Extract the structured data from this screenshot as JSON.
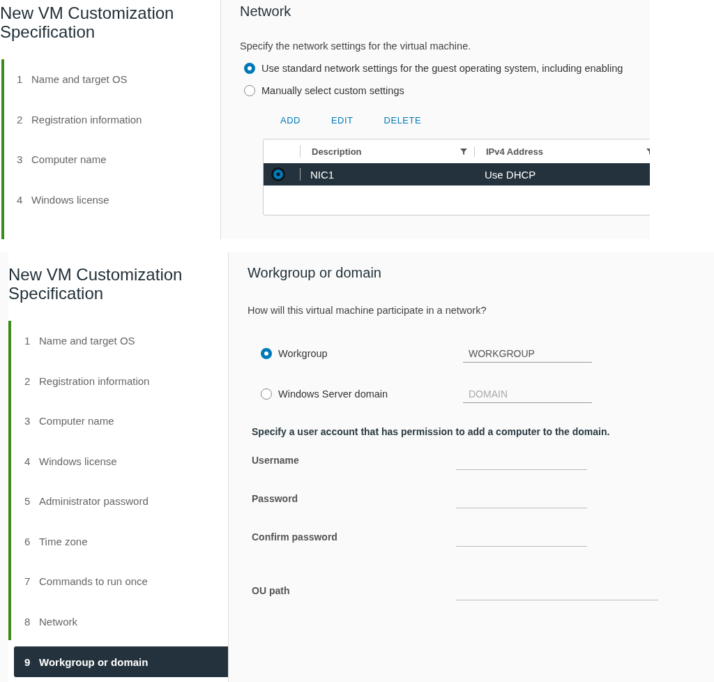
{
  "panels": [
    {
      "kind": "network",
      "title": "New VM Customization Specification",
      "steps": [
        {
          "number": "1",
          "label": "Name and target OS",
          "selected": false
        },
        {
          "number": "2",
          "label": "Registration information",
          "selected": false
        },
        {
          "number": "3",
          "label": "Computer name",
          "selected": false
        },
        {
          "number": "4",
          "label": "Windows license",
          "selected": false
        }
      ],
      "heading": "Network",
      "description": "Specify the network settings for the virtual machine.",
      "options": [
        {
          "label": "Use standard network settings for the guest operating system, including enabling",
          "selected": true
        },
        {
          "label": "Manually select custom settings",
          "selected": false
        }
      ],
      "actions": [
        "ADD",
        "EDIT",
        "DELETE"
      ],
      "table": {
        "columns": [
          "Description",
          "IPv4 Address"
        ],
        "rows": [
          {
            "cells": [
              "NIC1",
              "Use DHCP"
            ],
            "selected": true
          }
        ]
      }
    },
    {
      "kind": "workgroup",
      "title": "New VM Customization Specification",
      "steps": [
        {
          "number": "1",
          "label": "Name and target OS",
          "selected": false
        },
        {
          "number": "2",
          "label": "Registration information",
          "selected": false
        },
        {
          "number": "3",
          "label": "Computer name",
          "selected": false
        },
        {
          "number": "4",
          "label": "Windows license",
          "selected": false
        },
        {
          "number": "5",
          "label": "Administrator password",
          "selected": false
        },
        {
          "number": "6",
          "label": "Time zone",
          "selected": false
        },
        {
          "number": "7",
          "label": "Commands to run once",
          "selected": false
        },
        {
          "number": "8",
          "label": "Network",
          "selected": false
        },
        {
          "number": "9",
          "label": "Workgroup or domain",
          "selected": true
        }
      ],
      "heading": "Workgroup or domain",
      "description": "How will this virtual machine participate in a network?",
      "options": [
        {
          "label": "Workgroup",
          "selected": true,
          "value": "WORKGROUP"
        },
        {
          "label": "Windows Server domain",
          "selected": false,
          "placeholder": "DOMAIN"
        }
      ],
      "account_note": "Specify a user account that has permission to add a computer to the domain.",
      "fields": [
        {
          "label": "Username"
        },
        {
          "label": "Password"
        },
        {
          "label": "Confirm password"
        },
        {
          "label": "OU path",
          "wide": true
        }
      ]
    }
  ]
}
